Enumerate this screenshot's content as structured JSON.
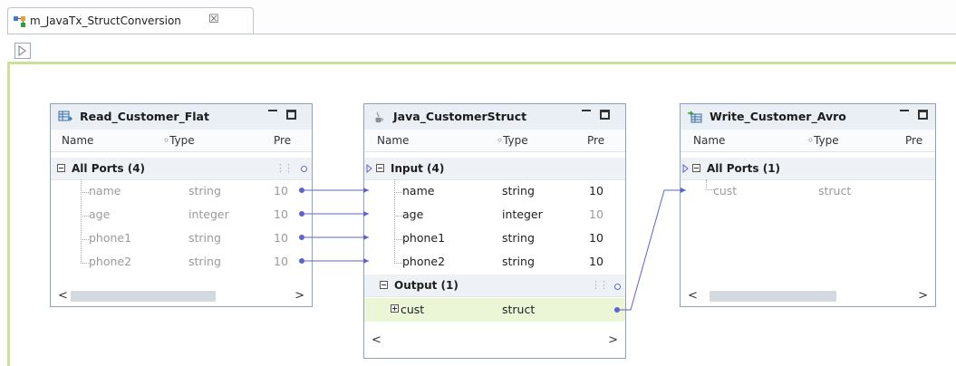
{
  "tab": {
    "title": "m_JavaTx_StructConversion",
    "close_glyph": "☒"
  },
  "colors": {
    "accent_link": "#5a62d6",
    "canvas_border": "#c9e19a",
    "selected_row": "#eaf6d6"
  },
  "columns": {
    "name": "Name",
    "type": "Type",
    "precision": "Pre"
  },
  "read": {
    "title": "Read_Customer_Flat",
    "group": "All Ports (4)",
    "ports": [
      {
        "name": "name",
        "type": "string",
        "precision": "10"
      },
      {
        "name": "age",
        "type": "integer",
        "precision": "10"
      },
      {
        "name": "phone1",
        "type": "string",
        "precision": "10"
      },
      {
        "name": "phone2",
        "type": "string",
        "precision": "10"
      }
    ]
  },
  "java": {
    "title": "Java_CustomerStruct",
    "input_group": "Input (4)",
    "inputs": [
      {
        "name": "name",
        "type": "string",
        "precision": "10"
      },
      {
        "name": "age",
        "type": "integer",
        "precision": "10"
      },
      {
        "name": "phone1",
        "type": "string",
        "precision": "10"
      },
      {
        "name": "phone2",
        "type": "string",
        "precision": "10"
      }
    ],
    "output_group": "Output (1)",
    "outputs": [
      {
        "name": "cust",
        "type": "struct"
      }
    ]
  },
  "write": {
    "title": "Write_Customer_Avro",
    "group": "All Ports (1)",
    "ports": [
      {
        "name": "cust",
        "type": "struct"
      }
    ]
  },
  "scroll": {
    "left": "<",
    "right": ">"
  }
}
